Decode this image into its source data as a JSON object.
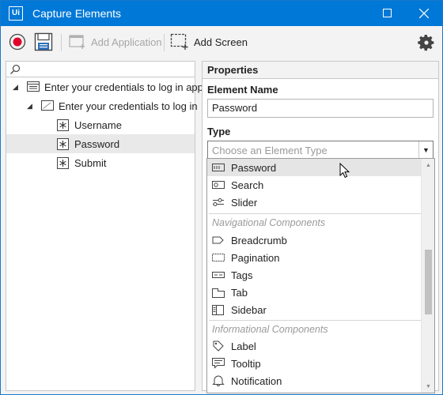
{
  "window": {
    "title": "Capture Elements",
    "app_icon": "Ui",
    "accent": "#0078d7"
  },
  "toolbar": {
    "add_application": "Add Application",
    "add_screen": "Add Screen"
  },
  "tree": {
    "items": [
      {
        "label": "Enter your credentials to log in app",
        "icon": "window-icon"
      },
      {
        "label": "Enter your credentials to log in",
        "icon": "screen-icon"
      },
      {
        "label": "Username",
        "icon": "asterisk-icon"
      },
      {
        "label": "Password",
        "icon": "asterisk-icon"
      },
      {
        "label": "Submit",
        "icon": "asterisk-icon"
      }
    ]
  },
  "properties": {
    "header": "Properties",
    "element_name_label": "Element Name",
    "element_name_value": "Password",
    "type_label": "Type",
    "type_placeholder": "Choose an Element Type"
  },
  "dropdown": {
    "items_top": [
      {
        "label": "Password",
        "icon": "password-field-icon"
      },
      {
        "label": "Search",
        "icon": "search-field-icon"
      },
      {
        "label": "Slider",
        "icon": "slider-icon"
      }
    ],
    "group_navigational": "Navigational Components",
    "items_nav": [
      {
        "label": "Breadcrumb",
        "icon": "breadcrumb-icon"
      },
      {
        "label": "Pagination",
        "icon": "pagination-icon"
      },
      {
        "label": "Tags",
        "icon": "tags-icon"
      },
      {
        "label": "Tab",
        "icon": "tab-icon"
      },
      {
        "label": "Sidebar",
        "icon": "sidebar-icon"
      }
    ],
    "group_informational": "Informational Components",
    "items_info": [
      {
        "label": "Label",
        "icon": "label-icon"
      },
      {
        "label": "Tooltip",
        "icon": "tooltip-icon"
      },
      {
        "label": "Notification",
        "icon": "notification-icon"
      }
    ]
  }
}
